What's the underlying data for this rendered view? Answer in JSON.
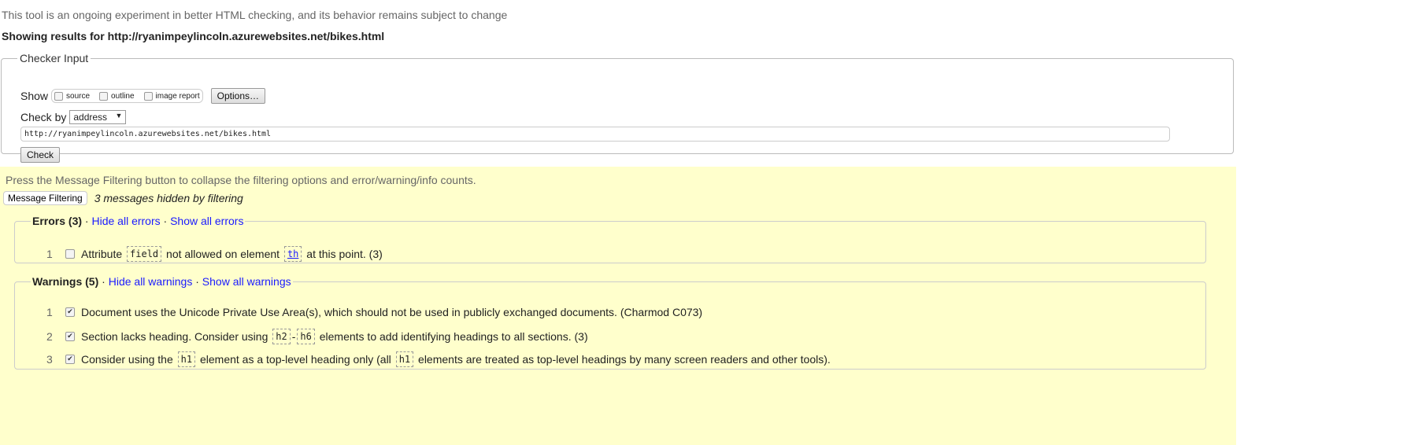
{
  "notice": "This tool is an ongoing experiment in better HTML checking, and its behavior remains subject to change",
  "showing_results": "Showing results for http://ryanimpeylincoln.azurewebsites.net/bikes.html",
  "checker_input": {
    "legend": "Checker Input",
    "show_label": "Show",
    "show_options": [
      {
        "label": "source",
        "checked": false
      },
      {
        "label": "outline",
        "checked": false
      },
      {
        "label": "image report",
        "checked": false
      }
    ],
    "options_button": "Options…",
    "check_by_label": "Check by",
    "check_by_value": "address",
    "dropdown_arrow": "▼",
    "url_value": "http://ryanimpeylincoln.azurewebsites.net/bikes.html",
    "check_button": "Check"
  },
  "filtering": {
    "instructions": "Press the Message Filtering button to collapse the filtering options and error/warning/info counts.",
    "button": "Message Filtering",
    "hidden_text": "3 messages hidden by filtering"
  },
  "errors": {
    "title": "Errors (3)",
    "sep": "·",
    "hide_all": "Hide all errors",
    "show_all": "Show all errors",
    "items": [
      {
        "num": "1",
        "checked": false,
        "t1": "Attribute",
        "c1": "field",
        "t2": "not allowed on element",
        "c2": "th",
        "t3": "at this point. (3)"
      }
    ]
  },
  "warnings": {
    "title": "Warnings (5)",
    "sep": "·",
    "hide_all": "Hide all warnings",
    "show_all": "Show all warnings",
    "items": [
      {
        "num": "1",
        "checked": true,
        "text": "Document uses the Unicode Private Use Area(s), which should not be used in publicly exchanged documents. (Charmod C073)"
      },
      {
        "num": "2",
        "checked": true,
        "t1": "Section lacks heading. Consider using",
        "c1": "h2",
        "dash": "-",
        "c2": "h6",
        "t2": "elements to add identifying headings to all sections. (3)"
      },
      {
        "num": "3",
        "checked": true,
        "t1": "Consider using the",
        "c1": "h1",
        "t2": "element as a top-level heading only (all",
        "c2": "h1",
        "t3": "elements are treated as top-level headings by many screen readers and other tools)."
      }
    ]
  }
}
